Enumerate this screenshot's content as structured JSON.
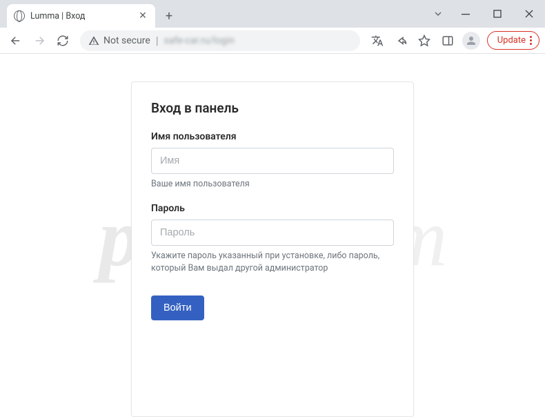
{
  "browser": {
    "tab_title": "Lumma | Вход",
    "addr_warning": "Not secure",
    "addr_url": "safe-car.ru/login",
    "update_label": "Update"
  },
  "login": {
    "title": "Вход в панель",
    "username_label": "Имя пользователя",
    "username_placeholder": "Имя",
    "username_hint": "Ваше имя пользователя",
    "password_label": "Пароль",
    "password_placeholder": "Пароль",
    "password_hint": "Укажите пароль указанный при установке, либо пароль, который Вам выдал другой администратор",
    "submit_label": "Войти"
  },
  "watermark": {
    "prefix": "pc",
    "suffix": "risk.com"
  }
}
